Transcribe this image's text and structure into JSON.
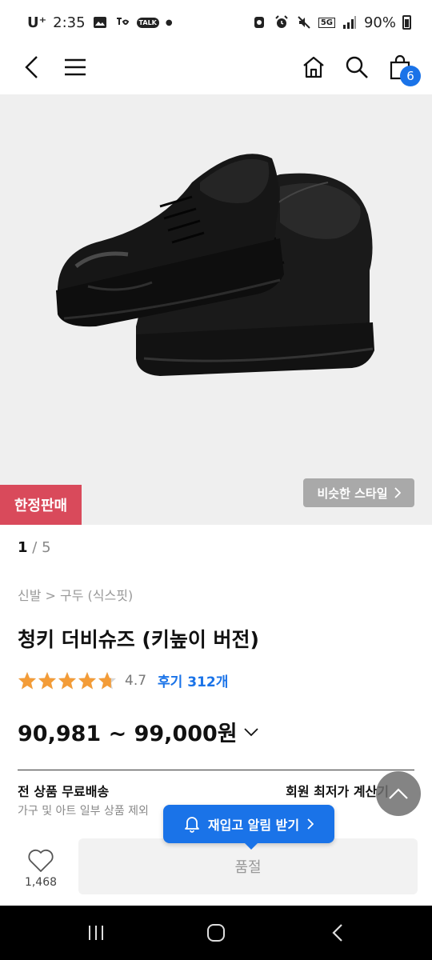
{
  "status_bar": {
    "carrier": "U⁺",
    "time": "2:35",
    "talk_label": "TALK",
    "network": "5G",
    "battery": "90%"
  },
  "nav": {
    "cart_count": "6"
  },
  "product": {
    "badge": "한정판매",
    "similar_label": "비슷한 스타일",
    "pager_current": "1",
    "pager_total": "5",
    "breadcrumb": "신발 > 구두 (식스핏)",
    "title": "청키 더비슈즈 (키높이 버전)",
    "rating": 4.7,
    "rating_label": "4.7",
    "review_label": "후기 312개",
    "price_range": "90,981 ~ 99,000원",
    "shipping_title": "전 상품 무료배송",
    "shipping_note": "가구 및 아트 일부 상품 제외",
    "calc_label": "회원 최저가 계산기"
  },
  "restock": {
    "label": "재입고 알림 받기"
  },
  "action_bar": {
    "wish_count": "1,468",
    "soldout_label": "품절"
  },
  "colors": {
    "accent": "#1a73e8",
    "badge": "#d94a5b",
    "star": "#f39c38"
  }
}
